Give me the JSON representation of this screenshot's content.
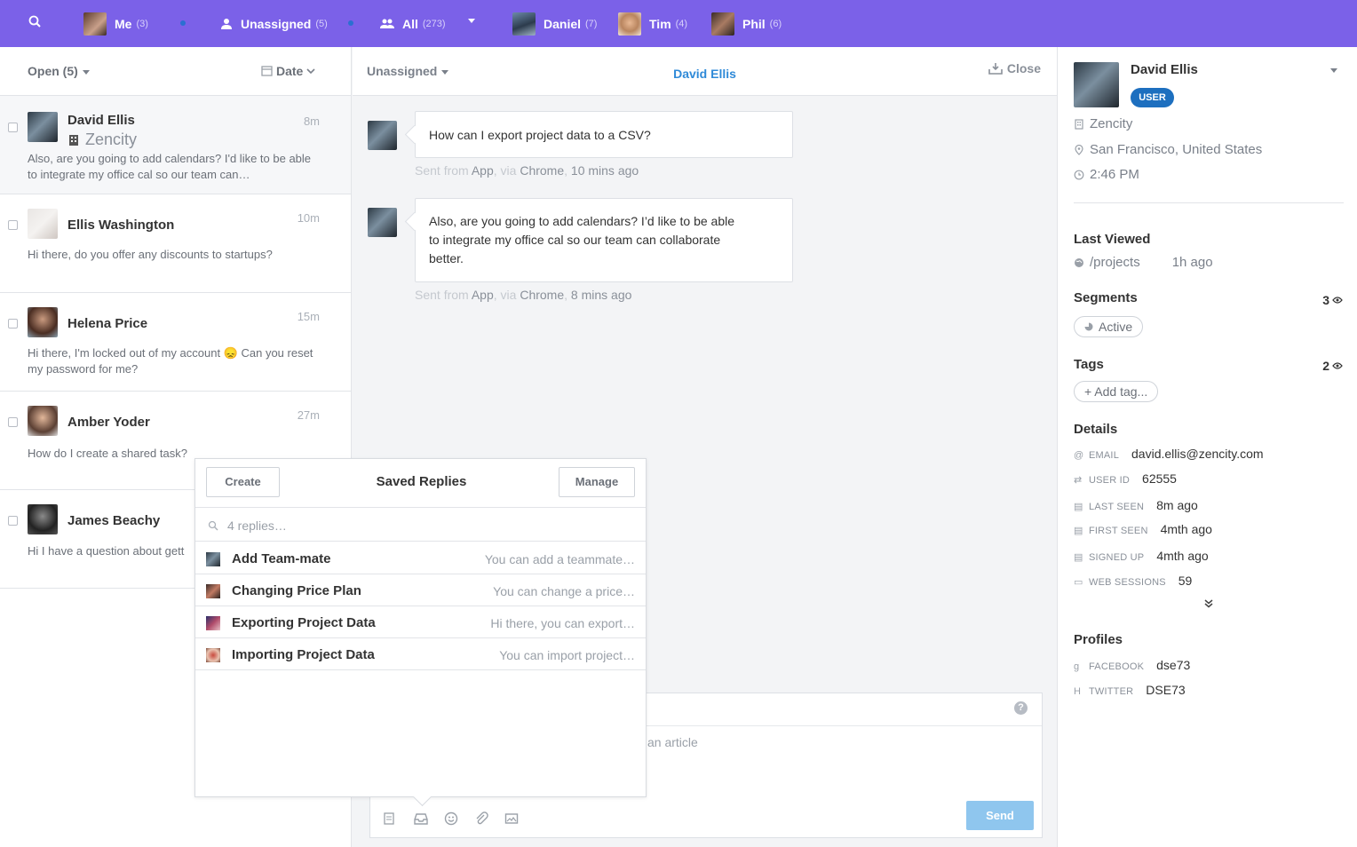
{
  "topbar": {
    "me": {
      "label": "Me",
      "count": "(3)"
    },
    "unassigned": {
      "label": "Unassigned",
      "count": "(5)"
    },
    "all": {
      "label": "All",
      "count": "(273)"
    },
    "teammates": [
      {
        "label": "Daniel",
        "count": "(7)"
      },
      {
        "label": "Tim",
        "count": "(4)"
      },
      {
        "label": "Phil",
        "count": "(6)"
      }
    ]
  },
  "inbox": {
    "filter": "Open (5)",
    "sort": "Date",
    "conversations": [
      {
        "name": "David Ellis",
        "company": "Zencity",
        "time": "8m",
        "preview": "Also, are you going to add calendars? I'd like to be able to integrate my office cal so our team can…"
      },
      {
        "name": "Ellis Washington",
        "time": "10m",
        "preview": "Hi there, do you offer any discounts to startups?"
      },
      {
        "name": "Helena Price",
        "time": "15m",
        "preview": "Hi there, I'm locked out of my account 😞 Can you reset my password for me?"
      },
      {
        "name": "Amber Yoder",
        "time": "27m",
        "preview": "How do I create a shared task?"
      },
      {
        "name": "James Beachy",
        "time": "",
        "preview": "Hi I have a question about gett"
      }
    ]
  },
  "conversation": {
    "assignee": "Unassigned",
    "title": "David Ellis",
    "close_label": "Close",
    "messages": [
      {
        "text": "How can I export project data to a CSV?",
        "sent": "Sent from",
        "app": "App",
        "via": ", via",
        "browser": "Chrome",
        "time": "10 mins ago"
      },
      {
        "text": "Also, are you going to add calendars? I’d like to be able to integrate my office cal so our team can collaborate better.",
        "sent": "Sent from",
        "app": "App",
        "via": ", via",
        "browser": "Chrome",
        "time": "8 mins ago"
      }
    ],
    "composer": {
      "placeholder": "an article",
      "send_label": "Send",
      "help": "?"
    }
  },
  "saved_replies": {
    "title": "Saved Replies",
    "create_label": "Create",
    "manage_label": "Manage",
    "search_placeholder": "4 replies…",
    "items": [
      {
        "title": "Add Team-mate",
        "preview": "You can add a teammate…"
      },
      {
        "title": "Changing Price Plan",
        "preview": "You can change a price…"
      },
      {
        "title": "Exporting Project Data",
        "preview": "Hi there, you can export…"
      },
      {
        "title": "Importing Project Data",
        "preview": "You can import project…"
      }
    ]
  },
  "user": {
    "name": "David Ellis",
    "badge": "USER",
    "company": "Zencity",
    "location": "San Francisco, United States",
    "local_time": "2:46 PM",
    "last_viewed": {
      "title": "Last Viewed",
      "page": "/projects",
      "time": "1h ago"
    },
    "segments": {
      "title": "Segments",
      "count": "3",
      "items": [
        "Active"
      ]
    },
    "tags": {
      "title": "Tags",
      "count": "2",
      "add_label": "+ Add tag..."
    },
    "details": {
      "title": "Details",
      "rows": [
        {
          "label": "EMAIL",
          "value": "david.ellis@zencity.com"
        },
        {
          "label": "USER ID",
          "value": "62555"
        },
        {
          "label": "LAST SEEN",
          "value": "8m ago"
        },
        {
          "label": "FIRST SEEN",
          "value": "4mth ago"
        },
        {
          "label": "SIGNED UP",
          "value": "4mth ago"
        },
        {
          "label": "WEB SESSIONS",
          "value": "59"
        }
      ]
    },
    "profiles": {
      "title": "Profiles",
      "rows": [
        {
          "icon": "g",
          "label": "FACEBOOK",
          "value": "dse73"
        },
        {
          "icon": "H",
          "label": "TWITTER",
          "value": "DSE73"
        }
      ]
    }
  },
  "colors": {
    "topbar": "#7b61e8",
    "accent": "#2f8ad8",
    "badge": "#1d6fbf",
    "send": "#8fc6ee"
  }
}
